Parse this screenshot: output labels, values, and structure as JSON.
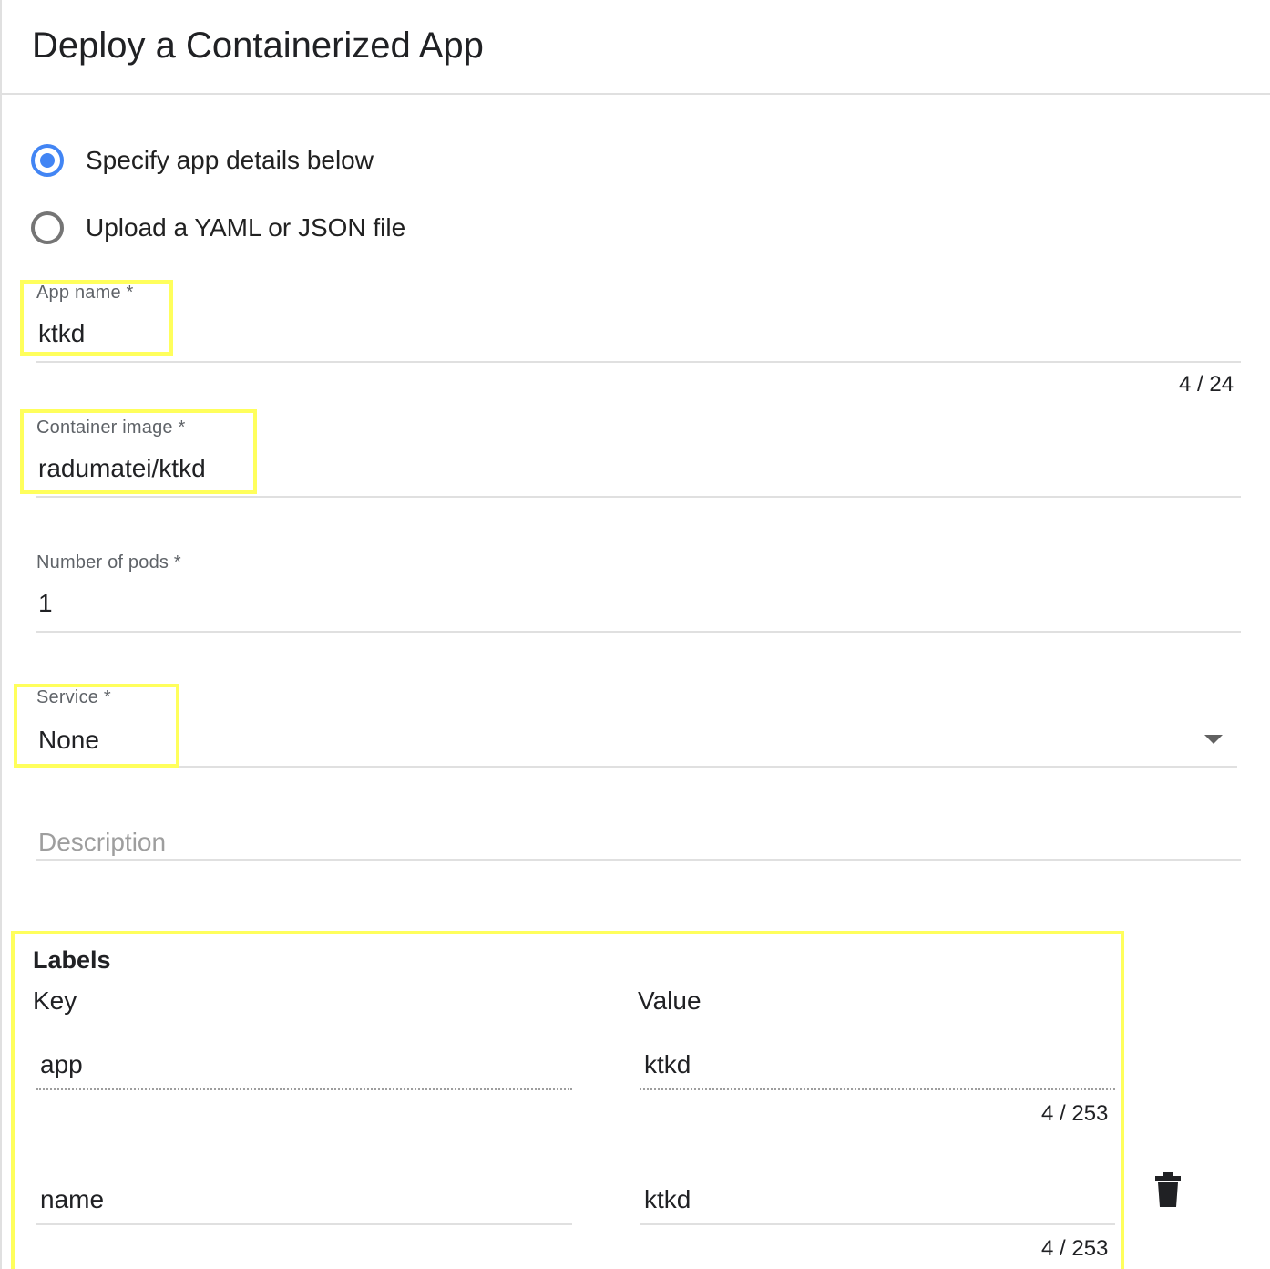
{
  "header": {
    "title": "Deploy a Containerized App"
  },
  "mode": {
    "options": [
      {
        "label": "Specify app details below",
        "selected": true
      },
      {
        "label": "Upload a YAML or JSON file",
        "selected": false
      }
    ]
  },
  "form": {
    "app_name": {
      "label": "App name *",
      "value": "ktkd",
      "counter": "4 / 24"
    },
    "container_image": {
      "label": "Container image *",
      "value": "radumatei/ktkd"
    },
    "pods": {
      "label": "Number of pods *",
      "value": "1"
    },
    "service": {
      "label": "Service *",
      "value": "None"
    },
    "description": {
      "placeholder": "Description"
    }
  },
  "labels": {
    "title": "Labels",
    "key_header": "Key",
    "value_header": "Value",
    "rows": [
      {
        "key": "app",
        "value": "ktkd",
        "counter": "4 / 253",
        "readonly": true
      },
      {
        "key": "name",
        "value": "ktkd",
        "counter": "4 / 253",
        "readonly": false
      }
    ]
  },
  "colors": {
    "accent": "#4285f4",
    "highlight": "#ffff5c"
  },
  "icons": {
    "delete": "trash-icon",
    "dropdown": "arrow-drop-down-icon"
  }
}
